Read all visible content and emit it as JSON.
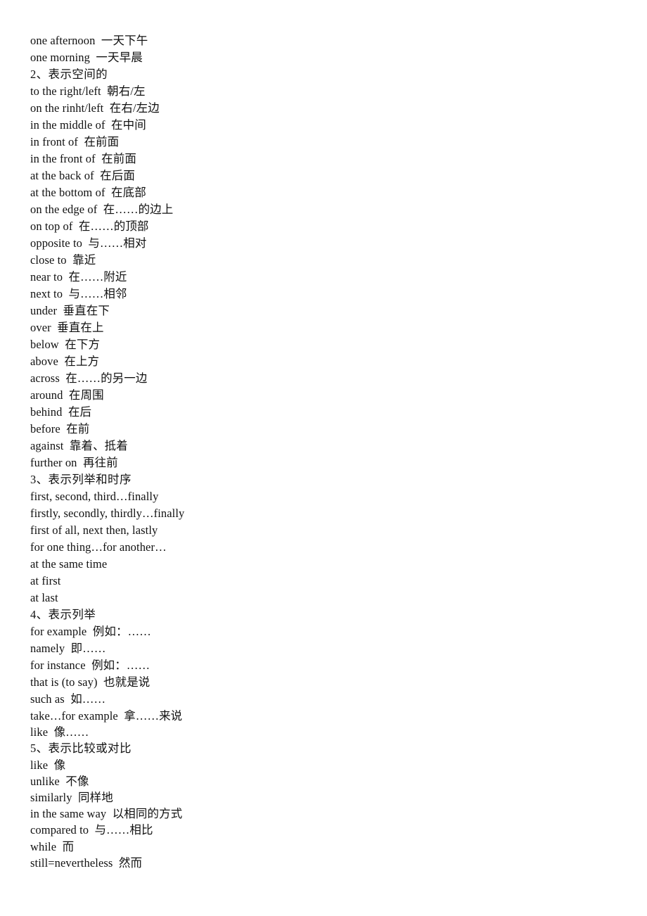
{
  "document": {
    "background_color": "#ffffff",
    "text_color": "#111111",
    "lines": [
      {
        "id": "l1",
        "text": "one afternoon  一天下午",
        "type": "entry"
      },
      {
        "id": "l2",
        "text": "one morning  一天早晨",
        "type": "entry"
      },
      {
        "id": "l3",
        "text": "2、表示空间的",
        "type": "heading"
      },
      {
        "id": "l4",
        "text": "to the right/left  朝右/左",
        "type": "entry"
      },
      {
        "id": "l5",
        "text": "on the rinht/left  在右/左边",
        "type": "entry"
      },
      {
        "id": "l6",
        "text": "in the middle of  在中间",
        "type": "entry"
      },
      {
        "id": "l7",
        "text": "in front of  在前面",
        "type": "entry"
      },
      {
        "id": "l8",
        "text": "in the front of  在前面",
        "type": "entry"
      },
      {
        "id": "l9",
        "text": "at the back of  在后面",
        "type": "entry"
      },
      {
        "id": "l10",
        "text": "at the bottom of  在底部",
        "type": "entry"
      },
      {
        "id": "l11",
        "text": "on the edge of  在……的边上",
        "type": "entry"
      },
      {
        "id": "l12",
        "text": "on top of  在……的顶部",
        "type": "entry"
      },
      {
        "id": "l13",
        "text": "opposite to  与……相对",
        "type": "entry"
      },
      {
        "id": "l14",
        "text": "close to  靠近",
        "type": "entry"
      },
      {
        "id": "l15",
        "text": "near to  在……附近",
        "type": "entry"
      },
      {
        "id": "l16",
        "text": "next to  与……相邻",
        "type": "entry"
      },
      {
        "id": "l17",
        "text": "under  垂直在下",
        "type": "entry"
      },
      {
        "id": "l18",
        "text": "over  垂直在上",
        "type": "entry"
      },
      {
        "id": "l19",
        "text": "below  在下方",
        "type": "entry"
      },
      {
        "id": "l20",
        "text": "above  在上方",
        "type": "entry"
      },
      {
        "id": "l21",
        "text": "across  在……的另一边",
        "type": "entry"
      },
      {
        "id": "l22",
        "text": "around  在周围",
        "type": "entry"
      },
      {
        "id": "l23",
        "text": "behind  在后",
        "type": "entry"
      },
      {
        "id": "l24",
        "text": "before  在前",
        "type": "entry"
      },
      {
        "id": "l25",
        "text": "against  靠着、抵着",
        "type": "entry"
      },
      {
        "id": "l26",
        "text": "further on  再往前",
        "type": "entry"
      },
      {
        "id": "l27",
        "text": "3、表示列举和时序",
        "type": "heading"
      },
      {
        "id": "l28",
        "text": "first, second, third…finally",
        "type": "entry"
      },
      {
        "id": "l29",
        "text": "firstly, secondly, thirdly…finally",
        "type": "entry"
      },
      {
        "id": "l30",
        "text": "first of all, next then, lastly",
        "type": "entry"
      },
      {
        "id": "l31",
        "text": "for one thing…for another…",
        "type": "entry"
      },
      {
        "id": "l32",
        "text": "at the same time",
        "type": "entry"
      },
      {
        "id": "l33",
        "text": "at first",
        "type": "entry"
      },
      {
        "id": "l34",
        "text": "at last",
        "type": "entry"
      },
      {
        "id": "l35",
        "text": "4、表示列举",
        "type": "heading"
      },
      {
        "id": "l36",
        "text": "for example  例如：……",
        "type": "entry"
      },
      {
        "id": "l37",
        "text": "namely  即……",
        "type": "entry"
      },
      {
        "id": "l38",
        "text": "for instance  例如：……",
        "type": "entry"
      },
      {
        "id": "l39",
        "text": "that is (to say)  也就是说",
        "type": "entry"
      },
      {
        "id": "l40",
        "text": "such as  如……",
        "type": "entry"
      },
      {
        "id": "l41",
        "text": "take…for example  拿……来说",
        "type": "entry"
      },
      {
        "id": "l42",
        "text": "like  像……",
        "type": "entry"
      },
      {
        "id": "l43",
        "text": "5、表示比较或对比",
        "type": "heading"
      },
      {
        "id": "l44",
        "text": "like  像",
        "type": "entry"
      },
      {
        "id": "l45",
        "text": "unlike  不像",
        "type": "entry"
      },
      {
        "id": "l46",
        "text": "similarly  同样地",
        "type": "entry"
      },
      {
        "id": "l47",
        "text": "in the same way  以相同的方式",
        "type": "entry"
      },
      {
        "id": "l48",
        "text": "compared to  与……相比",
        "type": "entry"
      },
      {
        "id": "l49",
        "text": "while  而",
        "type": "entry"
      },
      {
        "id": "l50",
        "text": "still=nevertheless  然而",
        "type": "entry"
      }
    ]
  }
}
